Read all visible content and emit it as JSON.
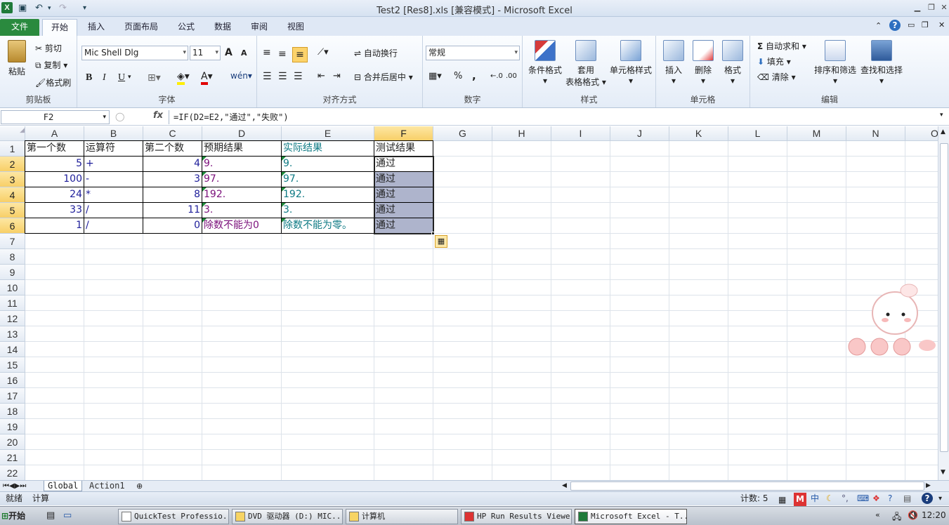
{
  "window": {
    "title": "Test2 [Res8].xls  [兼容模式] - Microsoft Excel",
    "app_icon": "X"
  },
  "quick_access": {
    "save": "save-icon",
    "undo": "↶",
    "redo": "↷",
    "customize": "▾"
  },
  "tabs": [
    "文件",
    "开始",
    "插入",
    "页面布局",
    "公式",
    "数据",
    "审阅",
    "视图"
  ],
  "ribbon": {
    "clipboard": {
      "name": "剪贴板",
      "paste": "粘贴",
      "cut": "剪切",
      "copy": "复制",
      "format_painter": "格式刷"
    },
    "font": {
      "name": "字体",
      "family": "Mic Shell Dlg",
      "size": "11",
      "grow": "A",
      "shrink": "A",
      "bold": "B",
      "italic": "I",
      "underline": "U",
      "wen": "wén"
    },
    "alignment": {
      "name": "对齐方式",
      "wrap": "自动换行",
      "merge": "合并后居中"
    },
    "number": {
      "name": "数字",
      "format": "常规",
      "percent": "%",
      "comma": ","
    },
    "styles": {
      "name": "样式",
      "conditional": "条件格式",
      "table_line1": "套用",
      "table_line2": "表格格式",
      "cell_styles": "单元格样式"
    },
    "cells": {
      "name": "单元格",
      "insert": "插入",
      "delete": "删除",
      "format": "格式"
    },
    "editing": {
      "name": "编辑",
      "autosum": "自动求和",
      "fill": "填充",
      "clear": "清除",
      "sort": "排序和筛选",
      "find": "查找和选择"
    }
  },
  "formula_bar": {
    "name_box": "F2",
    "fx": "fx",
    "formula": "=IF(D2=E2,\"通过\",\"失败\")"
  },
  "columns": [
    "A",
    "B",
    "C",
    "D",
    "E",
    "F",
    "G",
    "H",
    "I",
    "J",
    "K",
    "L",
    "M",
    "N",
    "O"
  ],
  "rows": [
    "1",
    "2",
    "3",
    "4",
    "5",
    "6",
    "7",
    "8",
    "9",
    "10",
    "11",
    "12",
    "13",
    "14",
    "15",
    "16",
    "17",
    "18",
    "19",
    "20",
    "21",
    "22"
  ],
  "table": {
    "headers": [
      "第一个数",
      "运算符",
      "第二个数",
      "预期结果",
      "实际结果",
      "测试结果"
    ],
    "rows": [
      [
        "5",
        "+",
        "4",
        "9.",
        "9.",
        "通过"
      ],
      [
        "100",
        "-",
        "3",
        "97.",
        "97.",
        "通过"
      ],
      [
        "24",
        "*",
        "8",
        "192.",
        "192.",
        "通过"
      ],
      [
        "33",
        "/",
        "11",
        "3.",
        "3.",
        "通过"
      ],
      [
        "1",
        "/",
        "0",
        "除数不能为0",
        "除数不能为零。",
        "通过"
      ]
    ]
  },
  "sheets": [
    "Global",
    "Action1"
  ],
  "status": {
    "ready": "就绪",
    "calc": "计算",
    "count": "计数: 5"
  },
  "taskbar": {
    "start": "开始",
    "items": [
      "QuickTest Professio...",
      "DVD 驱动器 (D:) MIC...",
      "计算机",
      "HP Run Results Viewer",
      "Microsoft Excel - T..."
    ],
    "clock": "12:20"
  },
  "colors": {
    "file_tab": "#2a8a3e",
    "selected_header": "#f8cf67",
    "selection_fill": "#aeb4cc"
  }
}
